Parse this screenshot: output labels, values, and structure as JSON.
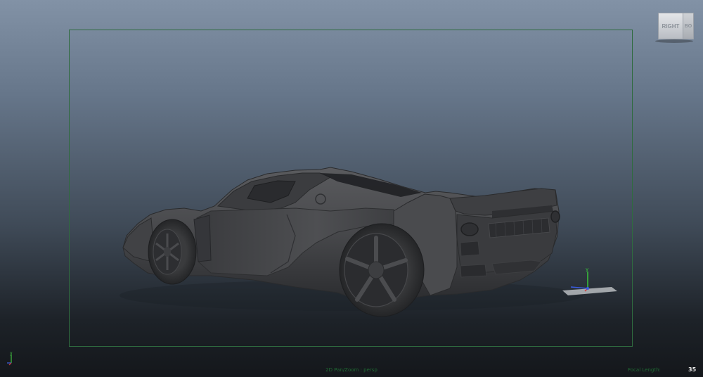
{
  "viewport": {
    "background_top": "#8292a6",
    "background_bottom": "#14171b",
    "resolution_gate_color": "#2f6b3f"
  },
  "view_cube": {
    "front_label": "RIGHT",
    "side_label": "BO"
  },
  "axis_triad": {
    "y_label": "y",
    "x_color": "#d04040",
    "y_color": "#40c040",
    "z_color": "#4060e0"
  },
  "manipulator": {
    "y_label": "y"
  },
  "hud": {
    "pan_zoom": "2D Pan/Zoom : persp",
    "focal_length_label": "Focal Length:",
    "focal_length_value": "35"
  },
  "model": {
    "name": "sports-car",
    "color": "#4a4b4d",
    "icon": "car-model"
  }
}
